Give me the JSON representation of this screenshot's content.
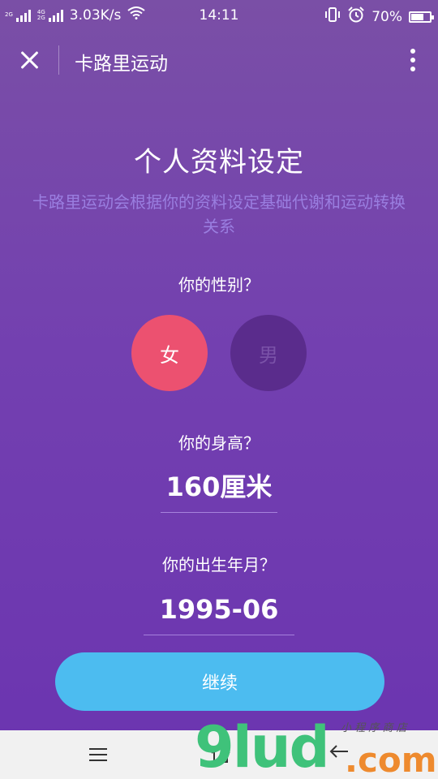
{
  "status_bar": {
    "sim1_tag": "2G",
    "sim2_tag_top": "4G",
    "sim2_tag_bottom": "2G",
    "net_speed": "3.03K/s",
    "time": "14:11",
    "battery": "70%",
    "battery_level": 0.7
  },
  "app_bar": {
    "title": "卡路里运动"
  },
  "main": {
    "title": "个人资料设定",
    "subtitle": "卡路里运动会根据你的资料设定基础代谢和运动转换关系",
    "gender_question": "你的性别？",
    "gender_female": "女",
    "gender_male": "男",
    "gender_selected": "女",
    "height_question": "你的身高？",
    "height_value": "160厘米",
    "birth_question": "你的出生年月？",
    "birth_value": "1995-06",
    "continue_label": "继续"
  },
  "watermark": {
    "brand": "9lud",
    "tld": ".com",
    "tagline": "小 程 序 商 店"
  },
  "colors": {
    "accent_female": "#ec5170",
    "male_unselected": "#5a2c8c",
    "continue_button": "#4cbcf0",
    "background": "#7340b0"
  }
}
